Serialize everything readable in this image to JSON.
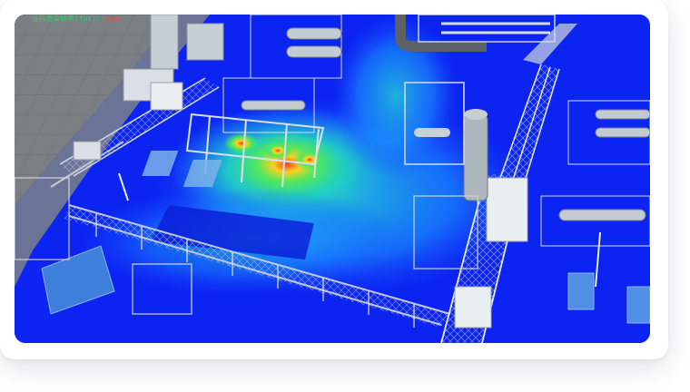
{
  "hud": {
    "label": "当前渲染帧率(fps)：",
    "value": "209",
    "label_color": "#2fd36a",
    "value_color": "#f24848"
  },
  "scene": {
    "description_icon": "3d-plant-scene",
    "heatmap_colors": [
      "#0a1ff0",
      "#1a8cff",
      "#21d7d0",
      "#33e07a",
      "#d6f02a",
      "#ff3b1f"
    ]
  }
}
